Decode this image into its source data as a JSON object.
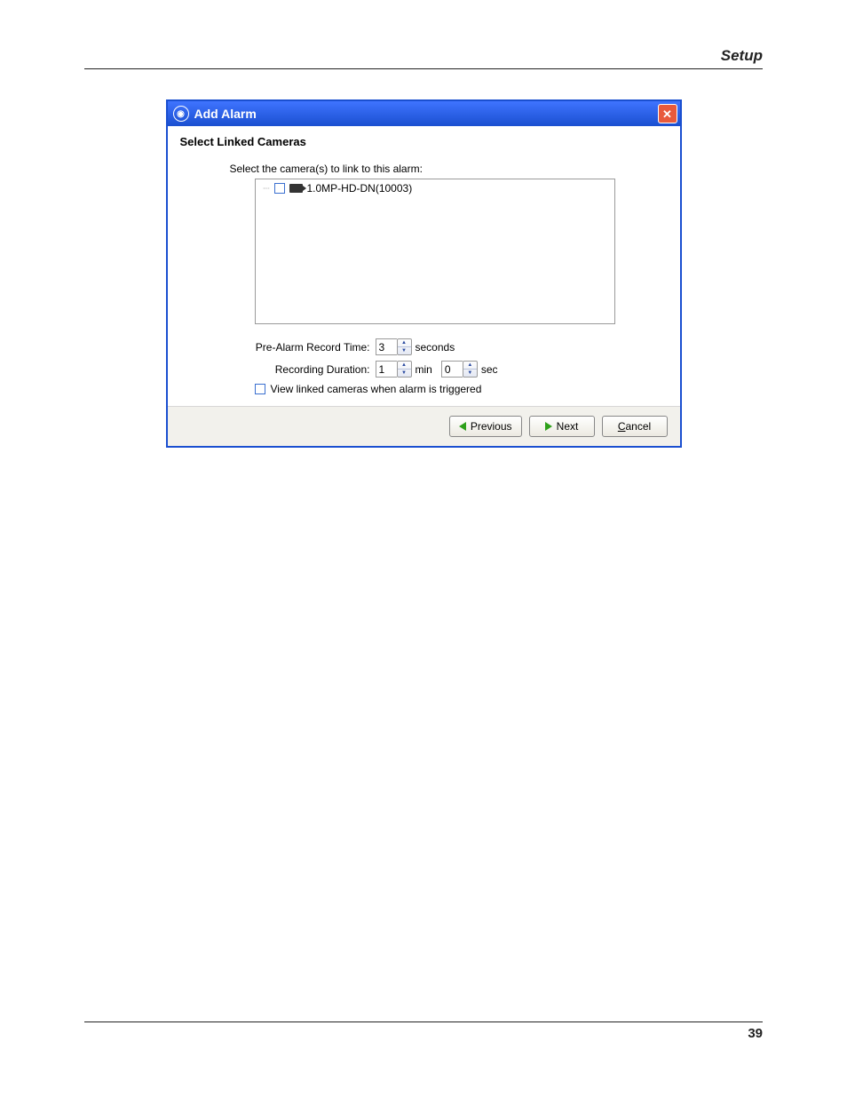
{
  "page": {
    "header": "Setup",
    "number": "39"
  },
  "dialog": {
    "title": "Add Alarm",
    "close_glyph": "✕",
    "section_title": "Select Linked Cameras",
    "instruction": "Select the camera(s) to link to this alarm:",
    "camera_item": "1.0MP-HD-DN(10003)",
    "pre_alarm": {
      "label": "Pre-Alarm Record Time:",
      "value": "3",
      "unit": "seconds"
    },
    "duration": {
      "label": "Recording Duration:",
      "min_value": "1",
      "min_unit": "min",
      "sec_value": "0",
      "sec_unit": "sec"
    },
    "view_linked_label": "View linked cameras when alarm is triggered",
    "buttons": {
      "previous": "Previous",
      "next": "Next",
      "cancel_mnemonic": "C",
      "cancel_rest": "ancel"
    }
  }
}
